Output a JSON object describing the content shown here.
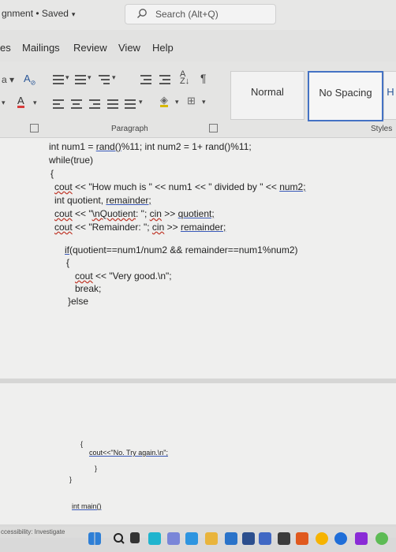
{
  "titlebar": {
    "doc_name": "gnment • Saved",
    "search_placeholder": "Search (Alt+Q)"
  },
  "menu": {
    "tabs": [
      "es",
      "Mailings",
      "Review",
      "View",
      "Help"
    ]
  },
  "ribbon": {
    "paragraph_label": "Paragraph",
    "styles_label": "Styles",
    "style_normal": "Normal",
    "style_no_spacing": "No Spacing",
    "pilcrow": "¶",
    "sort_icon": "sort-az-icon",
    "accent_color": "#4472c4"
  },
  "code": {
    "line1_a": "int num1 = ",
    "line1_rand1": "rand()",
    "line1_b": "%11; int num2 = 1+ rand()%11;",
    "line2": "while(true)",
    "line3": "{",
    "line4_cout": "cout",
    "line4_a": " << \"How much is \" << num1 << \" divided by \" << ",
    "line4_num2": "num2;",
    "line5_a": "int quotient, ",
    "line5_rem": "remainder;",
    "line6_cout": "cout",
    "line6_a": " << \"",
    "line6_q": "\\nQuotient",
    "line6_b": ": \"; ",
    "line6_cin": "cin",
    "line6_c": " >> ",
    "line6_quot": "quotient;",
    "line7_cout": "cout",
    "line7_a": " << \"Remainder: \"; ",
    "line7_cin": "cin",
    "line7_b": " >> ",
    "line7_rem": "remainder;",
    "line8_if": "if",
    "line8_a": "(quotient==num1/num2 && remainder==num1%num2)",
    "line9": "{",
    "line10_cout": "cout",
    "line10_a": " << \"Very good.\\n\";",
    "line11": "break;",
    "line12": "}else",
    "line13": "{",
    "line14": "cout<<\"No. Try again.\\n\";",
    "line15": "}",
    "line16": "}",
    "line17": "int main()"
  },
  "status": {
    "accessibility": "ccessibility: Investigate"
  }
}
